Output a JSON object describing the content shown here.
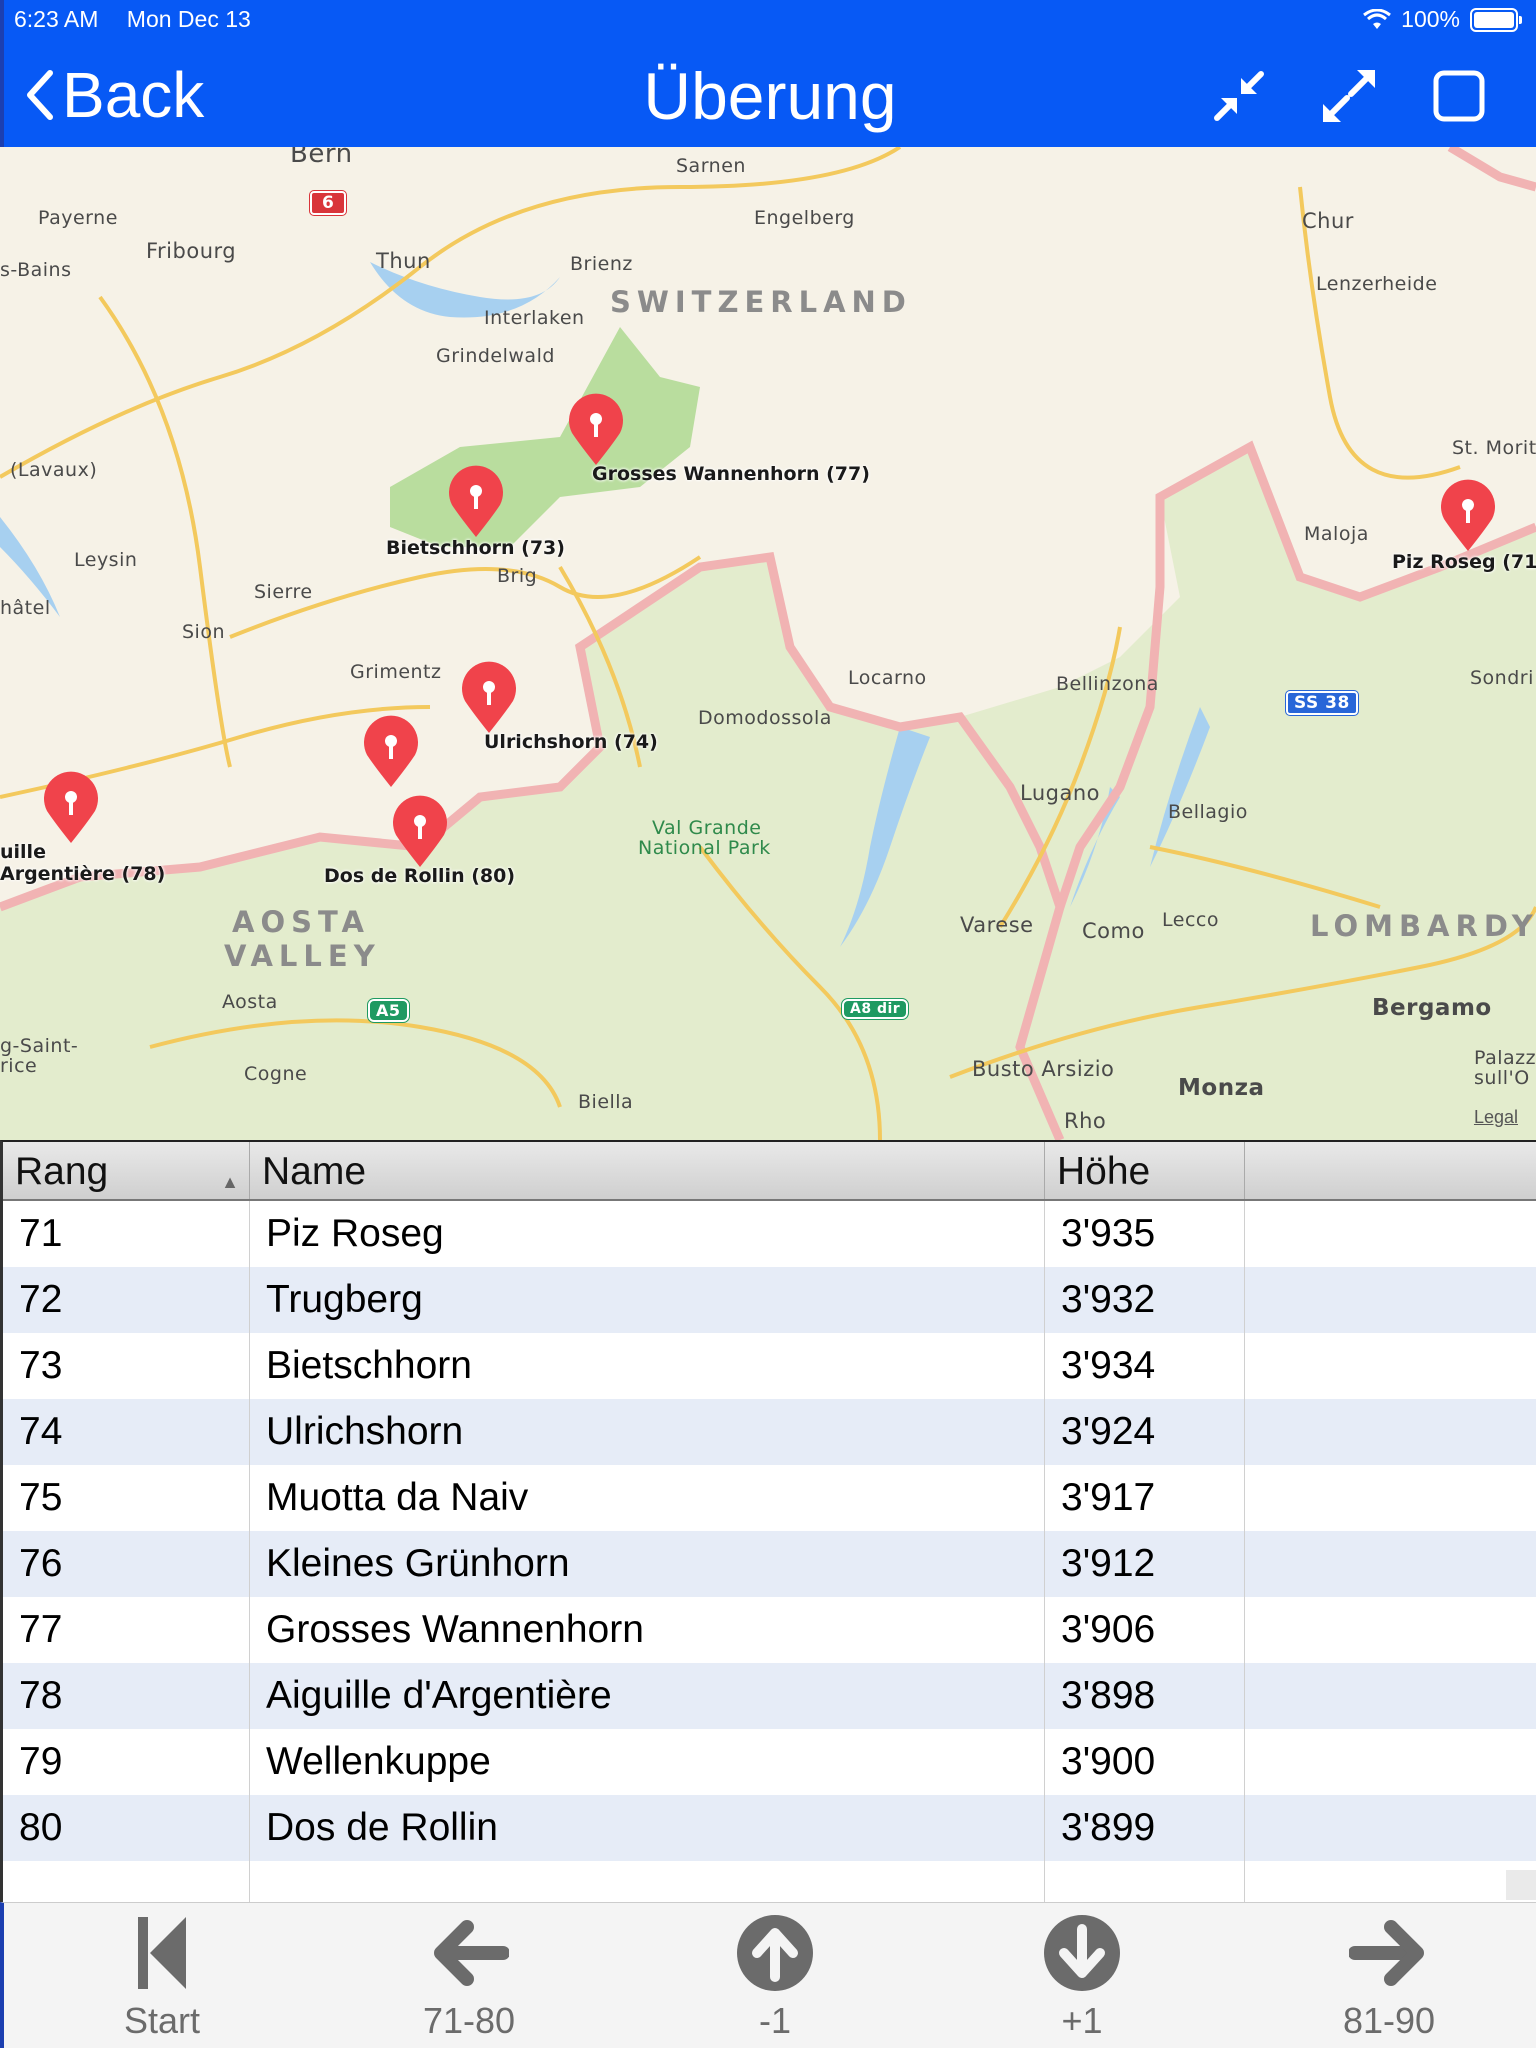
{
  "status_bar": {
    "time": "6:23 AM",
    "date": "Mon Dec 13",
    "battery": "100%"
  },
  "nav": {
    "back_label": "Back",
    "title": "Überung"
  },
  "map": {
    "place_labels": [
      {
        "text": "Bern"
      },
      {
        "text": "Sarnen"
      },
      {
        "text": "Engelberg"
      },
      {
        "text": "Chur"
      },
      {
        "text": "Payerne"
      },
      {
        "text": "Fribourg"
      },
      {
        "text": "s-Bains"
      },
      {
        "text": "Thun"
      },
      {
        "text": "Brienz"
      },
      {
        "text": "Lenzerheide"
      },
      {
        "text": "Interlaken"
      },
      {
        "text": "Grindelwald"
      },
      {
        "text": "St. Morit"
      },
      {
        "text": "(Lavaux)"
      },
      {
        "text": "Maloja"
      },
      {
        "text": "Leysin"
      },
      {
        "text": "Brig"
      },
      {
        "text": "Sierre"
      },
      {
        "text": "hâtel"
      },
      {
        "text": "Sion"
      },
      {
        "text": "Locarno"
      },
      {
        "text": "Bellinzona"
      },
      {
        "text": "Sondri"
      },
      {
        "text": "Grimentz"
      },
      {
        "text": "Domodossola"
      },
      {
        "text": "Lugano"
      },
      {
        "text": "Bellagio"
      },
      {
        "text": "Val Grande"
      },
      {
        "text": "National Park"
      },
      {
        "text": "Varese"
      },
      {
        "text": "Como"
      },
      {
        "text": "Lecco"
      },
      {
        "text": "Aosta"
      },
      {
        "text": "Bergamo"
      },
      {
        "text": "g-Saint-"
      },
      {
        "text": "rice"
      },
      {
        "text": "Cogne"
      },
      {
        "text": "Busto Arsizio"
      },
      {
        "text": "Palazz"
      },
      {
        "text": "sull'O"
      },
      {
        "text": "Biella"
      },
      {
        "text": "Monza"
      },
      {
        "text": "Rho"
      }
    ],
    "region_labels": [
      "SWITZERLAND",
      "AOSTA",
      "VALLEY",
      "LOMBARDY"
    ],
    "road_shields": [
      "6",
      "SS 38",
      "A5",
      "A8 dir"
    ],
    "pins": [
      {
        "label": "Grosses Wannenhorn (77)"
      },
      {
        "label": "Bietschhorn (73)"
      },
      {
        "label": "Piz Roseg (71"
      },
      {
        "label": "Ulrichshorn (74)"
      },
      {
        "label": ""
      },
      {
        "label": "uille"
      },
      {
        "label": "Argentière (78)"
      },
      {
        "label": "Dos de Rollin (80)"
      }
    ],
    "legal": "Legal"
  },
  "table": {
    "columns": [
      "Rang",
      "Name",
      "Höhe",
      ""
    ],
    "rows": [
      {
        "rang": "71",
        "name": "Piz Roseg",
        "hoehe": "3'935"
      },
      {
        "rang": "72",
        "name": "Trugberg",
        "hoehe": "3'932"
      },
      {
        "rang": "73",
        "name": "Bietschhorn",
        "hoehe": "3'934"
      },
      {
        "rang": "74",
        "name": "Ulrichshorn",
        "hoehe": "3'924"
      },
      {
        "rang": "75",
        "name": "Muotta da Naiv",
        "hoehe": "3'917"
      },
      {
        "rang": "76",
        "name": "Kleines Grünhorn",
        "hoehe": "3'912"
      },
      {
        "rang": "77",
        "name": "Grosses Wannenhorn",
        "hoehe": "3'906"
      },
      {
        "rang": "78",
        "name": "Aiguille d'Argentière",
        "hoehe": "3'898"
      },
      {
        "rang": "79",
        "name": "Wellenkuppe",
        "hoehe": "3'900"
      },
      {
        "rang": "80",
        "name": "Dos de Rollin",
        "hoehe": "3'899"
      },
      {
        "rang": "",
        "name": "",
        "hoehe": ""
      }
    ]
  },
  "toolbar": {
    "start": "Start",
    "prev_page": "71-80",
    "prev_one": "-1",
    "next_one": "+1",
    "next_page": "81-90"
  },
  "colors": {
    "header": "#0759f5",
    "pin": "#f0434b",
    "row_alt": "#e6ecf7"
  }
}
